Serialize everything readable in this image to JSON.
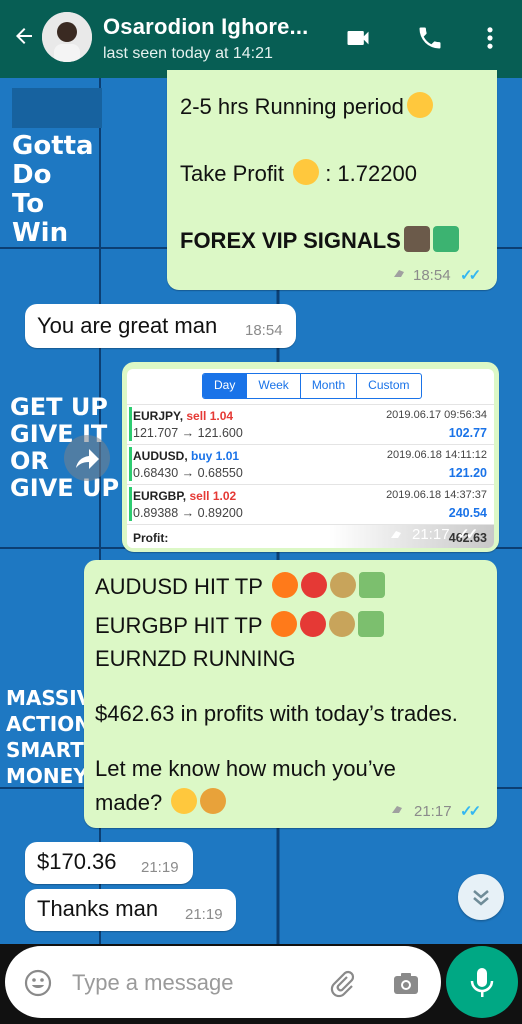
{
  "header": {
    "contact_name": "Osarodion Ighore...",
    "last_seen": "last seen today at 14:21"
  },
  "wallpaper": {
    "top_left": [
      "Gotta",
      "Do",
      "To",
      "Win"
    ],
    "middle_left": [
      "GET UP",
      "GIVE IT",
      "OR",
      "GIVE UP"
    ],
    "lower_left": [
      "MASSIV",
      "ACTION",
      "SMART",
      "MONEY"
    ]
  },
  "messages": [
    {
      "direction": "out",
      "lines": [
        "2-5 hrs Running period",
        "Take Profit",
        ": 1.72200",
        "FOREX VIP SIGNALS"
      ],
      "time": "18:54"
    },
    {
      "direction": "in",
      "text": "You are great man",
      "time": "18:54"
    },
    {
      "direction": "out",
      "type": "image",
      "time": "21:17",
      "screenshot": {
        "tabs": [
          "Day",
          "Week",
          "Month",
          "Custom"
        ],
        "active_tab": "Day",
        "trades": [
          {
            "symbol": "EURJPY,",
            "action": "sell 1.04",
            "rates": "121.707 → 121.600",
            "datetime": "2019.06.17 09:56:34",
            "profit": "102.77"
          },
          {
            "symbol": "AUDUSD,",
            "action": "buy 1.01",
            "rates": "0.68430 → 0.68550",
            "datetime": "2019.06.18 14:11:12",
            "profit": "121.20"
          },
          {
            "symbol": "EURGBP,",
            "action": "sell 1.02",
            "rates": "0.89388 → 0.89200",
            "datetime": "2019.06.18 14:37:37",
            "profit": "240.54"
          }
        ],
        "profit_label": "Profit:",
        "profit_total": "462.63"
      }
    },
    {
      "direction": "out",
      "lines": [
        "AUDUSD HIT TP",
        "EURGBP HIT TP",
        "EURNZD RUNNING",
        "$462.63 in profits with today’s trades.",
        "Let me know how much you’ve",
        "made?"
      ],
      "time": "21:17"
    },
    {
      "direction": "in",
      "text": "$170.36",
      "time": "21:19"
    },
    {
      "direction": "in",
      "text": "Thanks man",
      "time": "21:19"
    }
  ],
  "composer": {
    "placeholder": "Type a message"
  },
  "colors": {
    "header": "#075e54",
    "outgoing_bubble": "#dcf8c6",
    "incoming_bubble": "#ffffff",
    "wallpaper": "#1e78c2",
    "tick_read": "#34b7f1",
    "mic_button": "#00a884"
  },
  "icons": [
    "back-arrow-icon",
    "video-call-icon",
    "phone-icon",
    "more-vert-icon",
    "forward-icon",
    "scroll-down-icon",
    "emoji-icon",
    "attach-icon",
    "camera-icon",
    "mic-icon"
  ]
}
